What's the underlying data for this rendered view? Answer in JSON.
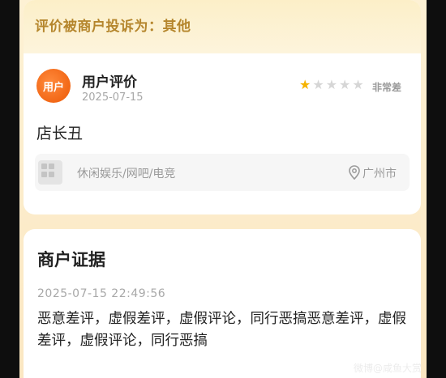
{
  "complaint": {
    "label": "评价被商户投诉为：其他"
  },
  "review": {
    "avatar_text": "用户",
    "reviewer_name": "用户评价",
    "date": "2025-07-15",
    "rating_value": 1,
    "rating_max": 5,
    "rating_text": "非常差",
    "content": "店长丑",
    "shop": {
      "category": "休闲娱乐/网吧/电竞",
      "city": "广州市"
    }
  },
  "evidence": {
    "title": "商户证据",
    "timestamp": "2025-07-15 22:49:56",
    "text": "恶意差评，虚假差评，虚假评论，同行恶搞恶意差评，虚假差评，虚假评论，同行恶搞"
  },
  "watermark": "微博@咸鱼大赏",
  "colors": {
    "accent_gold": "#b5862d",
    "avatar_orange": "#f26716",
    "star_on": "#f5b300",
    "star_off": "#d6d6d6"
  }
}
